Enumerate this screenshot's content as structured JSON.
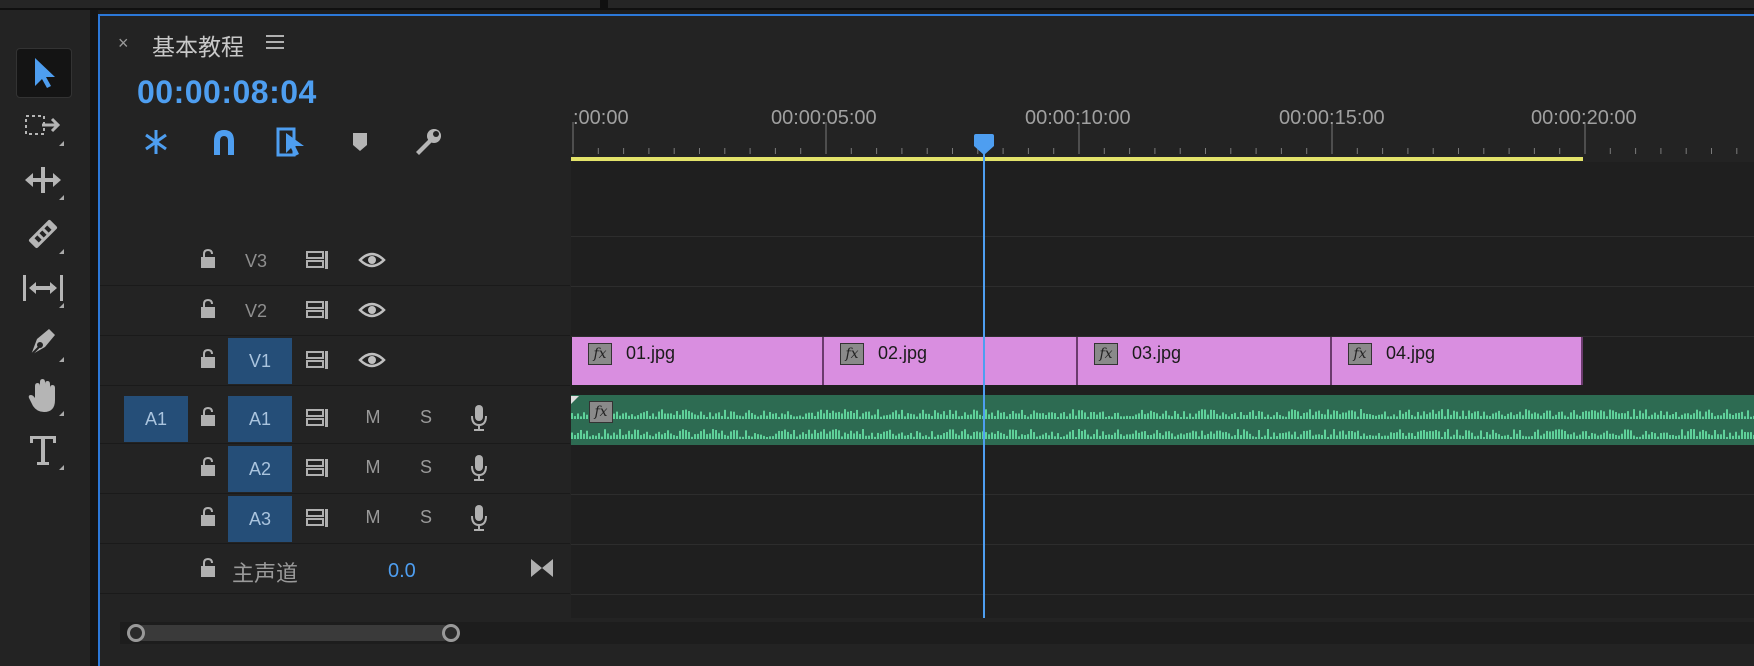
{
  "panel": {
    "title": "基本教程",
    "close_label": "×",
    "timecode": "00:00:08:04"
  },
  "tools": [
    {
      "name": "selection-tool-icon",
      "active": true
    },
    {
      "name": "track-select-forward-tool-icon",
      "active": false
    },
    {
      "name": "ripple-edit-tool-icon",
      "active": false
    },
    {
      "name": "razor-tool-icon",
      "active": false
    },
    {
      "name": "slip-tool-icon",
      "active": false
    },
    {
      "name": "pen-tool-icon",
      "active": false
    },
    {
      "name": "hand-tool-icon",
      "active": false
    },
    {
      "name": "type-tool-icon",
      "active": false
    }
  ],
  "ruler": {
    "labels": [
      ":00:00",
      "00:00:05:00",
      "00:00:10:00",
      "00:00:15:00",
      "00:00:20:00"
    ]
  },
  "tracks": {
    "video": [
      {
        "name": "V3",
        "targeted": false
      },
      {
        "name": "V2",
        "targeted": false
      },
      {
        "name": "V1",
        "targeted": true
      }
    ],
    "audio": [
      {
        "source": "A1",
        "name": "A1"
      },
      {
        "source": "",
        "name": "A2"
      },
      {
        "source": "",
        "name": "A3"
      }
    ],
    "mute_label": "M",
    "solo_label": "S",
    "master": {
      "label": "主声道",
      "value": "0.0"
    }
  },
  "clips": {
    "video": [
      {
        "name": "01.jpg",
        "fx": "fx"
      },
      {
        "name": "02.jpg",
        "fx": "fx"
      },
      {
        "name": "03.jpg",
        "fx": "fx"
      },
      {
        "name": "04.jpg",
        "fx": "fx"
      }
    ],
    "audio_fx": "fx"
  },
  "colors": {
    "accent": "#4e9ef0",
    "video_clip": "#d98ee0",
    "audio_clip": "#2d6b52",
    "waveform": "#5fd19a",
    "work_area": "#e3e36a",
    "track_target": "#254e78"
  }
}
